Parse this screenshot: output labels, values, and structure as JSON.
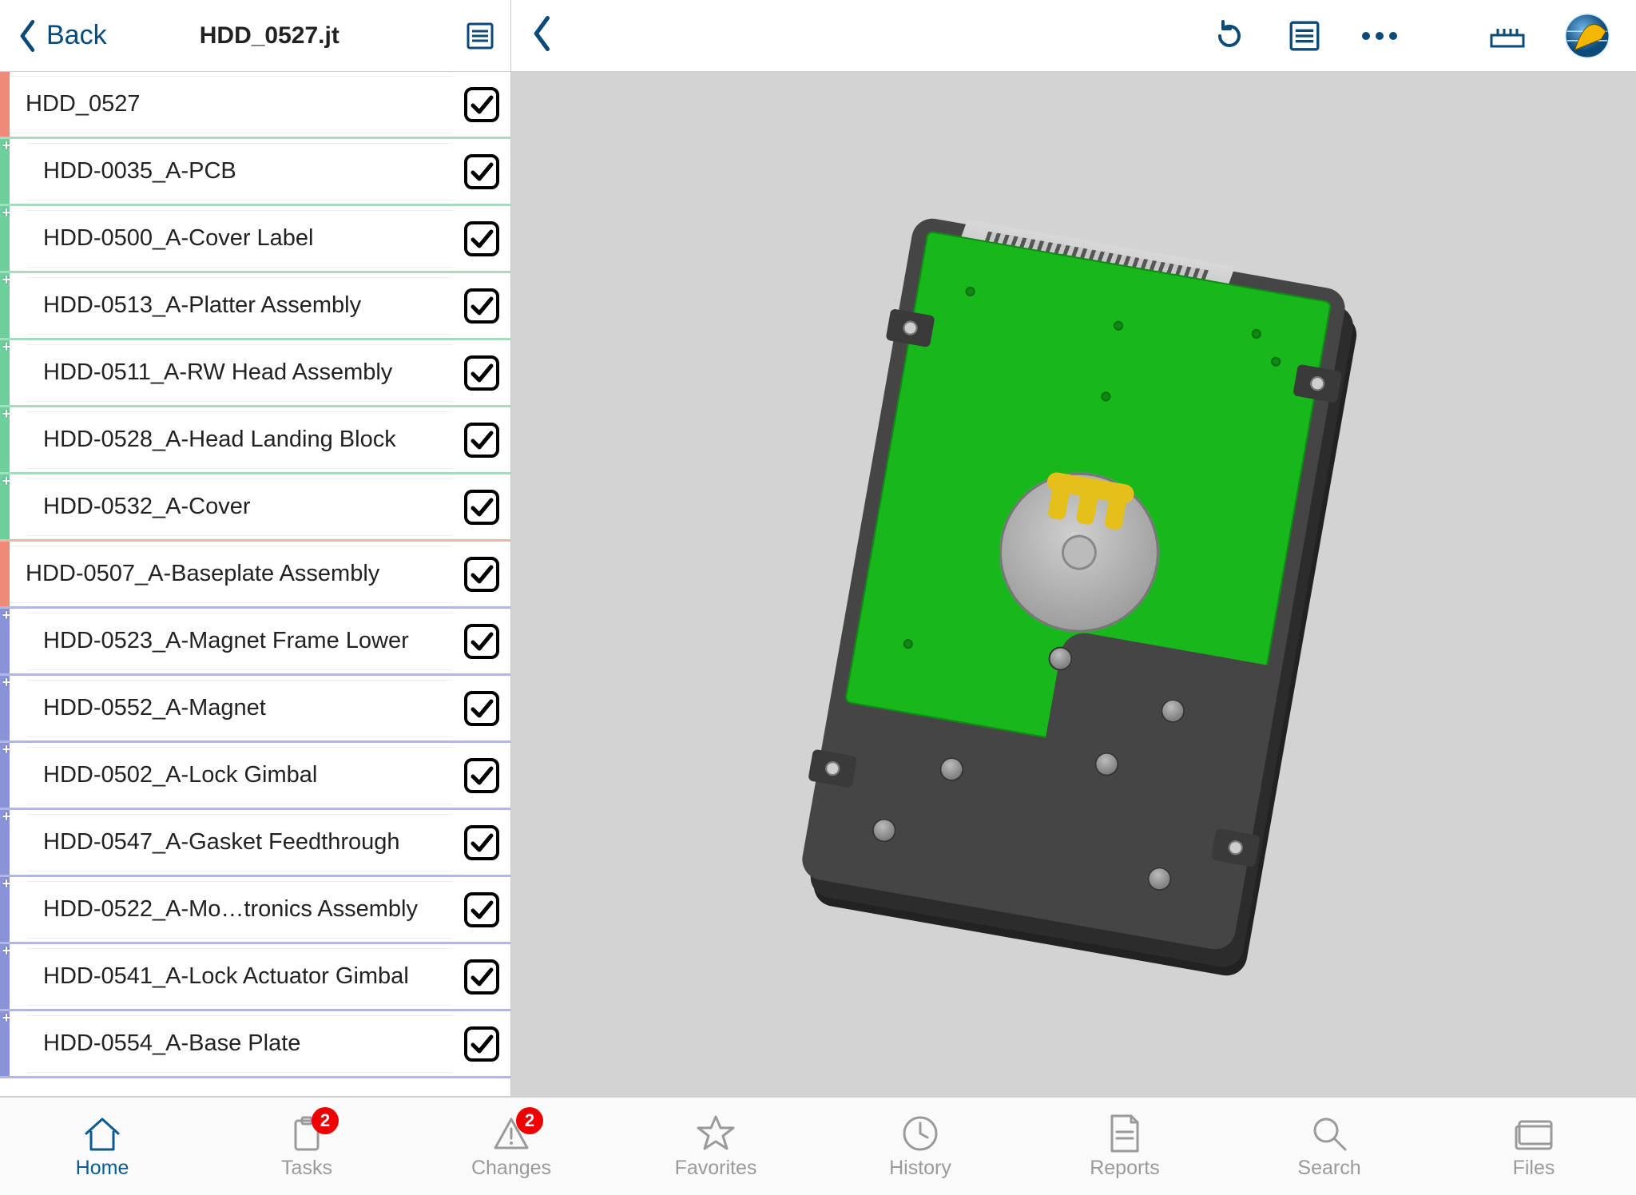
{
  "header": {
    "back_label": "Back",
    "title": "HDD_0527.jt"
  },
  "tree": [
    {
      "label": "HDD_0527",
      "depth": 0,
      "accent": "salmon",
      "sep": "green",
      "checked": true,
      "plus": false
    },
    {
      "label": "HDD-0035_A-PCB",
      "depth": 1,
      "accent": "green",
      "sep": "green",
      "checked": true,
      "plus": true
    },
    {
      "label": "HDD-0500_A-Cover Label",
      "depth": 1,
      "accent": "green",
      "sep": "green",
      "checked": true,
      "plus": true
    },
    {
      "label": "HDD-0513_A-Platter Assembly",
      "depth": 1,
      "accent": "green",
      "sep": "green",
      "checked": true,
      "plus": true
    },
    {
      "label": "HDD-0511_A-RW Head Assembly",
      "depth": 1,
      "accent": "green",
      "sep": "green",
      "checked": true,
      "plus": true
    },
    {
      "label": "HDD-0528_A-Head Landing Block",
      "depth": 1,
      "accent": "green",
      "sep": "green",
      "checked": true,
      "plus": true
    },
    {
      "label": "HDD-0532_A-Cover",
      "depth": 1,
      "accent": "green",
      "sep": "salmon",
      "checked": true,
      "plus": true
    },
    {
      "label": "HDD-0507_A-Baseplate Assembly",
      "depth": 0,
      "accent": "salmon",
      "sep": "blue",
      "checked": true,
      "plus": false
    },
    {
      "label": "HDD-0523_A-Magnet Frame Lower",
      "depth": 1,
      "accent": "blue",
      "sep": "blue",
      "checked": true,
      "plus": true
    },
    {
      "label": "HDD-0552_A-Magnet",
      "depth": 1,
      "accent": "blue",
      "sep": "blue",
      "checked": true,
      "plus": true
    },
    {
      "label": "HDD-0502_A-Lock Gimbal",
      "depth": 1,
      "accent": "blue",
      "sep": "blue",
      "checked": true,
      "plus": true
    },
    {
      "label": "HDD-0547_A-Gasket Feedthrough",
      "depth": 1,
      "accent": "blue",
      "sep": "blue",
      "checked": true,
      "plus": true
    },
    {
      "label": "HDD-0522_A-Mo…tronics Assembly",
      "depth": 1,
      "accent": "blue",
      "sep": "blue",
      "checked": true,
      "plus": true
    },
    {
      "label": "HDD-0541_A-Lock Actuator Gimbal",
      "depth": 1,
      "accent": "blue",
      "sep": "blue",
      "checked": true,
      "plus": true
    },
    {
      "label": "HDD-0554_A-Base Plate",
      "depth": 1,
      "accent": "blue",
      "sep": "blue",
      "checked": true,
      "plus": true
    }
  ],
  "tabs": [
    {
      "key": "home",
      "label": "Home",
      "active": true
    },
    {
      "key": "tasks",
      "label": "Tasks",
      "badge": "2"
    },
    {
      "key": "changes",
      "label": "Changes",
      "badge": "2"
    },
    {
      "key": "favorites",
      "label": "Favorites"
    },
    {
      "key": "history",
      "label": "History"
    },
    {
      "key": "reports",
      "label": "Reports"
    },
    {
      "key": "search",
      "label": "Search"
    },
    {
      "key": "files",
      "label": "Files"
    }
  ]
}
